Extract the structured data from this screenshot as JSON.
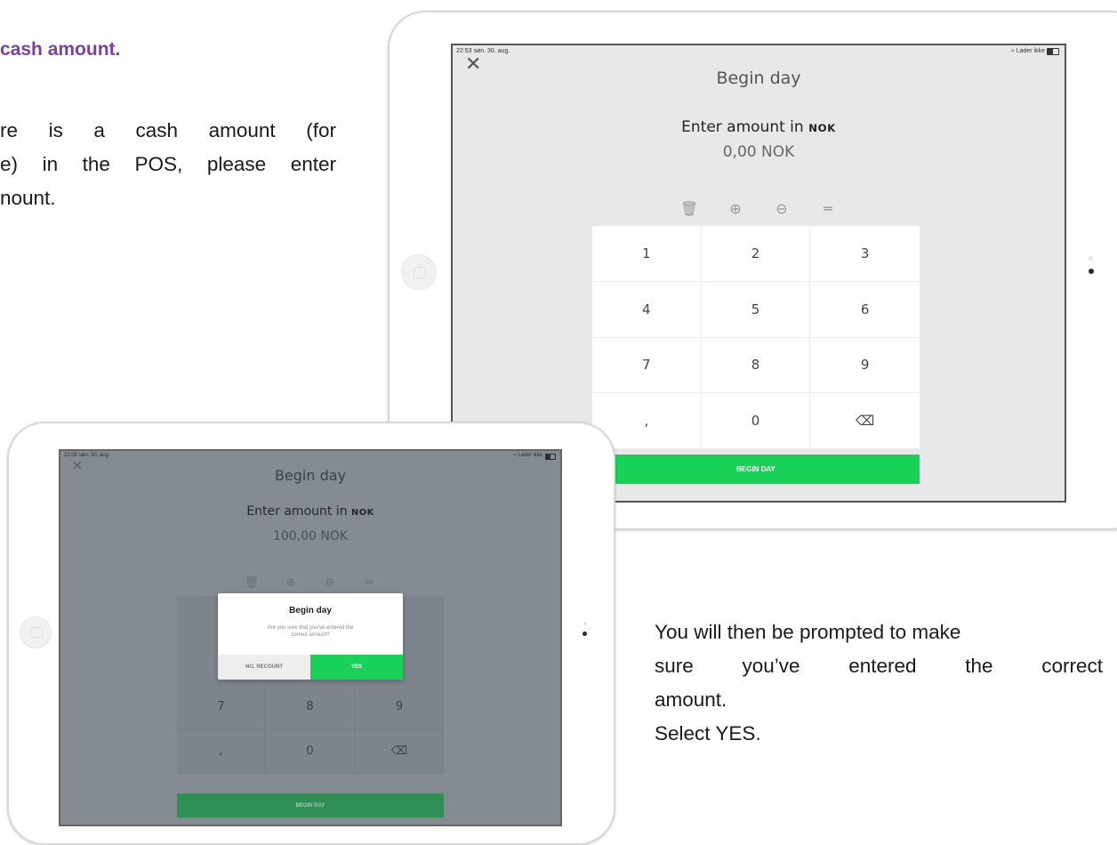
{
  "left_text": {
    "heading": "cash amount.",
    "lines": [
      "re is a cash amount (for",
      "e) in the POS, please enter",
      "nount."
    ]
  },
  "right_text": {
    "lines": [
      "You will then be prompted to make",
      "sure you’ve entered the correct",
      "amount.",
      "Select YES."
    ]
  },
  "screen1": {
    "status_time": "22:53  søn. 30. aug.",
    "status_right": "Lader ikke",
    "close_icon": "close-icon",
    "title": "Begin day",
    "enter_label": "Enter amount in",
    "currency": "NOK",
    "amount": "0,00 NOK",
    "tools": [
      "trash-icon",
      "plus-circle-icon",
      "minus-circle-icon",
      "equals-icon"
    ],
    "keys": [
      "1",
      "2",
      "3",
      "4",
      "5",
      "6",
      "7",
      "8",
      "9",
      ",",
      "0",
      "⌫"
    ],
    "begin_button": "BEGIN DAY"
  },
  "screen2": {
    "status_time": "23:03  søn. 30. aug.",
    "status_right": "Lader ikke",
    "title": "Begin day",
    "enter_label": "Enter amount in",
    "currency": "NOK",
    "amount": "100,00 NOK",
    "visible_keys": [
      "7",
      "8",
      "9",
      ",",
      "0",
      "⌫"
    ],
    "begin_button": "BEGIN DAY",
    "dialog": {
      "title": "Begin day",
      "message_line1": "Are you sure that you’ve entered the",
      "message_line2": "correct amount?",
      "no_button": "NO, RECOUNT",
      "yes_button": "YES"
    }
  },
  "colors": {
    "heading": "#7b3fa6",
    "green": "#1ad158",
    "screen_bg": "#e6e8ea",
    "overlay_bg": "#848b93"
  }
}
